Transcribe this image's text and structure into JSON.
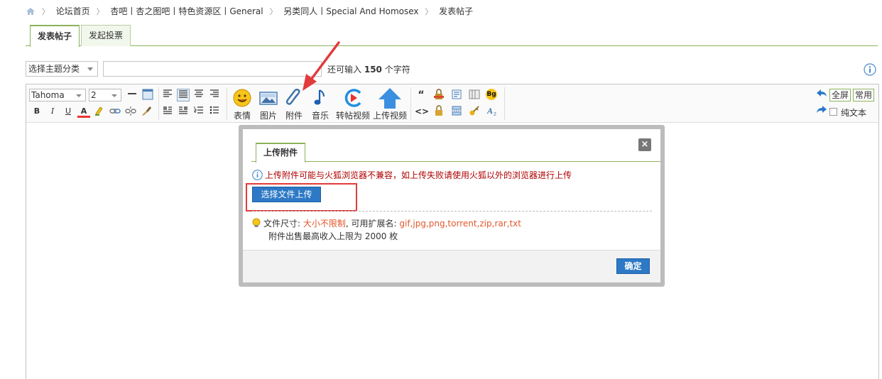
{
  "breadcrumb": {
    "items": [
      "论坛首页",
      "杏吧丨杏之图吧丨特色资源区丨General",
      "另类同人丨Special And Homosex",
      "发表帖子"
    ]
  },
  "tabs": [
    "发表帖子",
    "发起投票"
  ],
  "title_row": {
    "category_select": "选择主题分类",
    "title_value": "",
    "limit_prefix": "还可输入",
    "limit_count": "150",
    "limit_suffix": "个字符"
  },
  "toolbar": {
    "font_family": "Tahoma",
    "font_size": "2",
    "format_glyphs": {
      "bold": "B",
      "italic": "I",
      "underline": "U",
      "color": "A"
    },
    "big_buttons": [
      "表情",
      "图片",
      "附件",
      "音乐",
      "转帖视频",
      "上传视频"
    ],
    "quote_glyph": "“",
    "code_glyph": "<>",
    "bg_glyph": "Bg",
    "fullscreen": "全屏",
    "common": "常用",
    "plain_text": "纯文本"
  },
  "modal": {
    "tab": "上传附件",
    "close": "×",
    "warning": "上传附件可能与火狐浏览器不兼容，如上传失败请使用火狐以外的浏览器进行上传",
    "upload_button": "选择文件上传",
    "size_label": "文件尺寸:",
    "size_value": "大小不限制",
    "ext_label": ", 可用扩展名:",
    "ext_value": "gif,jpg,png,torrent,zip,rar,txt",
    "sell_limit": "附件出售最高收入上限为 2000 枚",
    "ok": "确定"
  },
  "colors": {
    "accent_green": "#8bb35a",
    "button_blue": "#2d79c6",
    "warning_red": "#b00000",
    "annotation_red": "#e23b3b"
  }
}
